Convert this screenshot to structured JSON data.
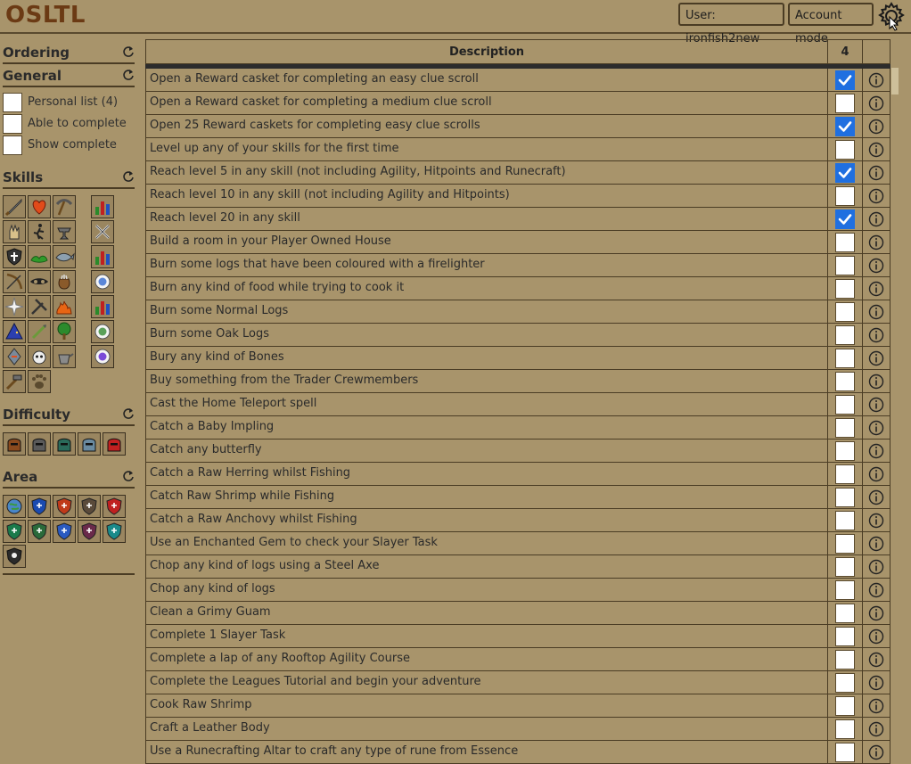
{
  "app": {
    "logo": "OSLTL"
  },
  "header": {
    "user_button": "User: ironfish2new",
    "account_button": "Account mode",
    "settings_icon": "gear-icon"
  },
  "sidebar": {
    "ordering": "Ordering",
    "general": "General",
    "filters": [
      {
        "label": "Personal list (4)"
      },
      {
        "label": "Able to complete"
      },
      {
        "label": "Show complete"
      }
    ],
    "skills": "Skills",
    "difficulty": "Difficulty",
    "area": "Area"
  },
  "table": {
    "col_description": "Description",
    "col_count": "4",
    "rows": [
      {
        "desc": "Open a Reward casket for completing an easy clue scroll",
        "checked": true
      },
      {
        "desc": "Open a Reward casket for completing a medium clue scroll",
        "checked": false
      },
      {
        "desc": "Open 25 Reward caskets for completing easy clue scrolls",
        "checked": true
      },
      {
        "desc": "Level up any of your skills for the first time",
        "checked": false
      },
      {
        "desc": "Reach level 5 in any skill (not including Agility, Hitpoints and Runecraft)",
        "checked": true
      },
      {
        "desc": "Reach level 10 in any skill (not including Agility and Hitpoints)",
        "checked": false
      },
      {
        "desc": "Reach level 20 in any skill",
        "checked": true
      },
      {
        "desc": "Build a room in your Player Owned House",
        "checked": false
      },
      {
        "desc": "Burn some logs that have been coloured with a firelighter",
        "checked": false
      },
      {
        "desc": "Burn any kind of food while trying to cook it",
        "checked": false
      },
      {
        "desc": "Burn some Normal Logs",
        "checked": false
      },
      {
        "desc": "Burn some Oak Logs",
        "checked": false
      },
      {
        "desc": "Bury any kind of Bones",
        "checked": false
      },
      {
        "desc": "Buy something from the Trader Crewmembers",
        "checked": false
      },
      {
        "desc": "Cast the Home Teleport spell",
        "checked": false
      },
      {
        "desc": "Catch a Baby Impling",
        "checked": false
      },
      {
        "desc": "Catch any butterfly",
        "checked": false
      },
      {
        "desc": "Catch a Raw Herring whilst Fishing",
        "checked": false
      },
      {
        "desc": "Catch Raw Shrimp while Fishing",
        "checked": false
      },
      {
        "desc": "Catch a Raw Anchovy whilst Fishing",
        "checked": false
      },
      {
        "desc": "Use an Enchanted Gem to check your Slayer Task",
        "checked": false
      },
      {
        "desc": "Chop any kind of logs using a Steel Axe",
        "checked": false
      },
      {
        "desc": "Chop any kind of logs",
        "checked": false
      },
      {
        "desc": "Clean a Grimy Guam",
        "checked": false
      },
      {
        "desc": "Complete 1 Slayer Task",
        "checked": false
      },
      {
        "desc": "Complete a lap of any Rooftop Agility Course",
        "checked": false
      },
      {
        "desc": "Complete the Leagues Tutorial and begin your adventure",
        "checked": false
      },
      {
        "desc": "Cook Raw Shrimp",
        "checked": false
      },
      {
        "desc": "Craft a Leather Body",
        "checked": false
      },
      {
        "desc": "Use a Runecrafting Altar to craft any type of rune from Essence",
        "checked": false
      }
    ]
  }
}
